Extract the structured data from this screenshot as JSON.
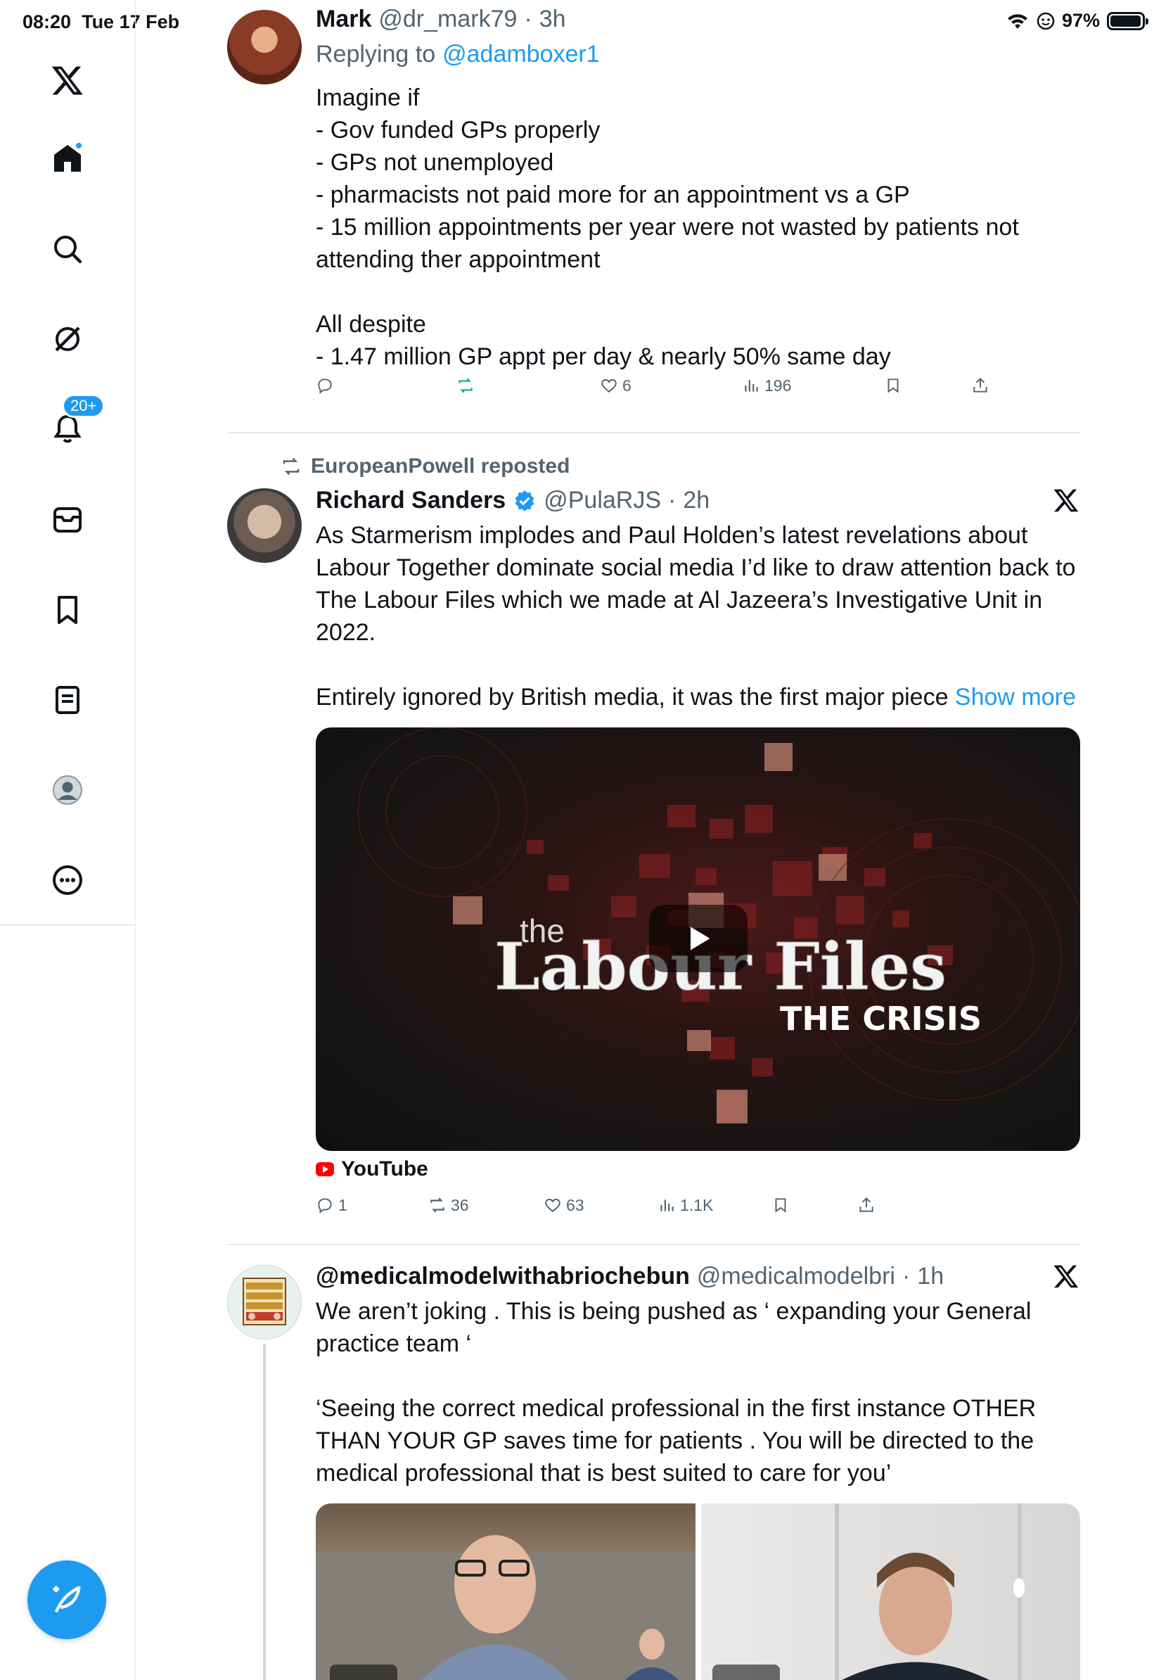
{
  "status": {
    "time": "08:20",
    "date": "Tue 17 Feb",
    "battery": "97%",
    "battery_level": 0.97
  },
  "rail": {
    "notification_badge": "20+",
    "items": [
      "x-logo-icon",
      "home-icon",
      "search-icon",
      "grok-icon",
      "notifications-icon",
      "messages-icon",
      "bookmarks-icon",
      "lists-icon",
      "profile-icon",
      "more-icon"
    ]
  },
  "colors": {
    "accent": "#1d9bf0",
    "text": "#0f1419",
    "muted": "#536471",
    "retweet_green": "#00ba7c"
  },
  "tweet1": {
    "name": "Mark",
    "handle": "@dr_mark79",
    "time": "3h",
    "replying_prefix": "Replying to",
    "replying_to": "@adamboxer1",
    "text": "Imagine if\n- Gov funded GPs properly\n- GPs not unemployed\n- pharmacists not paid more for an appointment vs a GP\n- 15 million appointments per year were not wasted by patients not attending ther appointment\n\nAll despite\n- 1.47 million GP appt per day & nearly 50% same day",
    "likes": "6",
    "views": "196"
  },
  "tweet2": {
    "repost_label": "EuropeanPowell reposted",
    "name": "Richard Sanders",
    "handle": "@PulaRJS",
    "time": "2h",
    "text": "As Starmerism implodes and Paul Holden’s latest revelations about Labour Together dominate social media I’d like to draw attention back to The Labour Files which we made at Al Jazeera’s Investigative Unit in 2022.\n\nEntirely ignored by British media, it was the first major piece ",
    "show_more": "Show more",
    "video": {
      "title_small": "the",
      "title_big": "Labour Files",
      "subtitle": "THE CRISIS"
    },
    "source": "YouTube",
    "replies": "1",
    "reposts": "36",
    "likes": "63",
    "views": "1.1K"
  },
  "tweet3": {
    "name": "@medicalmodelwithabriochebun",
    "handle": "@medicalmodelbri",
    "time": "1h",
    "text": "We aren’t joking . This is being pushed as ‘ expanding your General practice team ‘\n\n‘Seeing the correct medical professional in the first instance OTHER THAN YOUR GP saves time for patients . You will be directed to the medical professional that is best suited to care for you’"
  }
}
